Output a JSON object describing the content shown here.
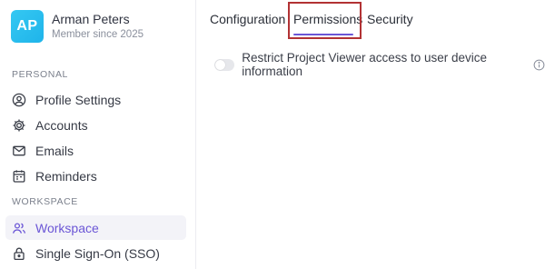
{
  "profile": {
    "initials": "AP",
    "name": "Arman Peters",
    "subtitle": "Member since 2025"
  },
  "sidebar": {
    "personal_label": "PERSONAL",
    "personal_items": [
      {
        "label": "Profile Settings",
        "icon": "user-circle-icon"
      },
      {
        "label": "Accounts",
        "icon": "gear-icon"
      },
      {
        "label": "Emails",
        "icon": "mail-icon"
      },
      {
        "label": "Reminders",
        "icon": "calendar-icon"
      }
    ],
    "workspace_label": "WORKSPACE",
    "workspace_items": [
      {
        "label": "Workspace",
        "icon": "users-icon",
        "active": true
      },
      {
        "label": "Single Sign-On (SSO)",
        "icon": "lock-icon"
      }
    ]
  },
  "tabs": [
    {
      "label": "Configuration"
    },
    {
      "label": "Permissions",
      "active": true
    },
    {
      "label": "Security"
    }
  ],
  "settings": {
    "restrict_viewer_label": "Restrict Project Viewer access to user device information",
    "restrict_viewer_enabled": false
  },
  "colors": {
    "accent": "#6b56d6",
    "avatar": "#2bbdf0",
    "highlight_border": "#b23234"
  }
}
